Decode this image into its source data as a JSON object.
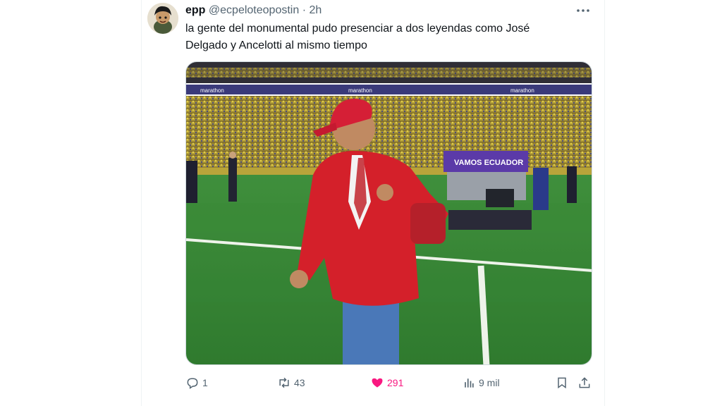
{
  "tweet": {
    "author_name": "epp",
    "author_handle": "@ecpeloteopostin",
    "separator": "·",
    "time": "2h",
    "text_line1": "la gente del monumental pudo presenciar a dos leyendas como José",
    "text_line2": "Delgado y Ancelotti al mismo tiempo"
  },
  "media": {
    "banner_text": "VAMOS ECUADOR",
    "ad_board_text": "marathon"
  },
  "actions": {
    "replies": "1",
    "retweets": "43",
    "likes": "291",
    "views": "9 mil"
  },
  "icons": {
    "more": "more-horizontal-icon",
    "reply": "reply-icon",
    "retweet": "retweet-icon",
    "like": "heart-filled-icon",
    "views": "analytics-icon",
    "bookmark": "bookmark-icon",
    "share": "share-icon"
  },
  "colors": {
    "like_active": "#f91880",
    "secondary_text": "#536471",
    "primary_text": "#0f1419"
  }
}
